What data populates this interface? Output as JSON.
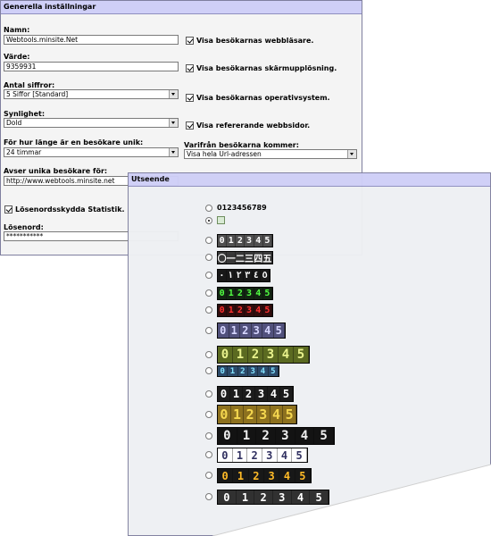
{
  "settings": {
    "title": "Generella inställningar",
    "name_label": "Namn:",
    "name_value": "Webtools.minsite.Net",
    "value_label": "Värde:",
    "value_value": "9359931",
    "digits_label": "Antal siffror:",
    "digits_value": "5 Siffor [Standard]",
    "visibility_label": "Synlighet:",
    "visibility_value": "Dold",
    "unique_label": "För hur länge är en besökare unik:",
    "unique_value": "24 timmar",
    "unique_for_label": "Avser unika besökare för:",
    "unique_for_value": "http://www.webtools.minsite.net",
    "password_protect_label": "Lösenordsskydda Statistik.",
    "password_label": "Lösenord:",
    "password_value": "***********",
    "origin_label": "Varifrån besökarna kommer:",
    "origin_value": "Visa hela Url-adressen",
    "checks": [
      {
        "label": "Visa besökarnas webbläsare.",
        "checked": true
      },
      {
        "label": "Visa besökarnas skärmupplösning.",
        "checked": true
      },
      {
        "label": "Visa besökarnas operativsystem.",
        "checked": true
      },
      {
        "label": "Visa refererande webbsidor.",
        "checked": true
      }
    ]
  },
  "appearance": {
    "title": "Utseende",
    "option1_text": "0123456789",
    "selected_index": 1,
    "styles": [
      {
        "digits": [
          "0",
          "1",
          "2",
          "3",
          "4",
          "5"
        ],
        "bg": "#2a2a2a",
        "fg": "#ffffff",
        "cell": "#4a4a4a",
        "shown": true
      },
      {
        "digits": [
          "〇",
          "一",
          "二",
          "三",
          "四",
          "五"
        ],
        "bg": "#333333",
        "fg": "#ffffff",
        "cell": "#333333",
        "shown": true
      },
      {
        "digits": [
          "٠",
          "١",
          "٢",
          "٣",
          "٤",
          "٥"
        ],
        "bg": "#111111",
        "fg": "#ffffff",
        "cell": "#111111",
        "shown": true
      },
      {
        "digits": [
          "0",
          "1",
          "2",
          "3",
          "4",
          "5"
        ],
        "bg": "#0b1d0b",
        "fg": "#4dff3d",
        "cell": "#0b1d0b",
        "shown": true
      },
      {
        "digits": [
          "0",
          "1",
          "2",
          "3",
          "4",
          "5"
        ],
        "bg": "#2a0606",
        "fg": "#ff2a2a",
        "cell": "#2a0606",
        "shown": true
      },
      {
        "digits": [
          "0",
          "1",
          "2",
          "3",
          "4",
          "5"
        ],
        "bg": "#39395c",
        "fg": "#d6d6ff",
        "cell": "#4c4c78",
        "shown": true
      },
      {
        "digits": [
          "0",
          "1",
          "2",
          "3",
          "4",
          "5"
        ],
        "bg": "#3d4a0f",
        "fg": "#e9f28a",
        "cell": "#56661a",
        "shown": true
      },
      {
        "digits": [
          "0",
          "1",
          "2",
          "3",
          "4",
          "5"
        ],
        "bg": "#1a2e44",
        "fg": "#7fe2ff",
        "cell": "#254566",
        "shown": true
      },
      {
        "digits": [
          "0",
          "1",
          "2",
          "3",
          "4",
          "5"
        ],
        "bg": "#151515",
        "fg": "#ffffff",
        "cell": "#151515",
        "shown": true
      },
      {
        "digits": [
          "0",
          "1",
          "2",
          "3",
          "4",
          "5"
        ],
        "bg": "#5a4710",
        "fg": "#f5d64a",
        "cell": "#8a6d18",
        "shown": true
      },
      {
        "digits": [
          "0",
          "1",
          "2",
          "3",
          "4",
          "5"
        ],
        "bg": "#0c0c0c",
        "fg": "#f0f0f0",
        "cell": "#0c0c0c",
        "shown": true
      },
      {
        "digits": [
          "0",
          "1",
          "2",
          "3",
          "4",
          "5"
        ],
        "bg": "#c9cfee",
        "fg": "#2b2b5c",
        "cell": "#ffffff",
        "shown": true
      },
      {
        "digits": [
          "0",
          "1",
          "2",
          "3",
          "4",
          "5"
        ],
        "bg": "#111111",
        "fg": "#ffb820",
        "cell": "#111111",
        "shown": true
      },
      {
        "digits": [
          "0",
          "1",
          "2",
          "3",
          "4",
          "5"
        ],
        "bg": "#0f0f0f",
        "fg": "#ffffff",
        "cell": "#2b2b2b",
        "shown": true
      }
    ]
  }
}
